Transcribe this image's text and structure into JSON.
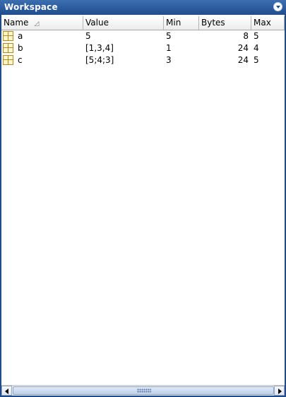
{
  "panel": {
    "title": "Workspace",
    "menu_icon": "dropdown-menu-icon"
  },
  "table": {
    "columns": [
      {
        "label": "Name",
        "sorted": "ascending"
      },
      {
        "label": "Value"
      },
      {
        "label": "Min"
      },
      {
        "label": "Bytes"
      },
      {
        "label": "Max"
      }
    ],
    "rows": [
      {
        "icon": "matrix-variable-icon",
        "name": "a",
        "value": "5",
        "min": "5",
        "bytes": "8",
        "max": "5"
      },
      {
        "icon": "matrix-variable-icon",
        "name": "b",
        "value": "[1,3,4]",
        "min": "1",
        "bytes": "24",
        "max": "4"
      },
      {
        "icon": "matrix-variable-icon",
        "name": "c",
        "value": "[5;4;3]",
        "min": "3",
        "bytes": "24",
        "max": "5"
      }
    ]
  },
  "scrollbar": {
    "orientation": "horizontal"
  },
  "colors": {
    "title_bar": "#1e4d8f",
    "icon_fill": "#fff6c8"
  }
}
